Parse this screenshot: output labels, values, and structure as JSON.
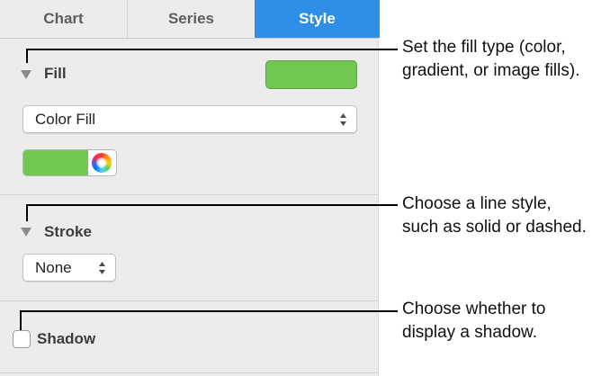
{
  "tabs": [
    {
      "label": "Chart",
      "active": false
    },
    {
      "label": "Series",
      "active": false
    },
    {
      "label": "Style",
      "active": true
    }
  ],
  "fill": {
    "title": "Fill",
    "swatch_color": "#71c751",
    "fill_type_value": "Color Fill",
    "well_color": "#71c751",
    "wheel_icon": "color-wheel-icon"
  },
  "stroke": {
    "title": "Stroke",
    "line_style_value": "None"
  },
  "shadow": {
    "label": "Shadow",
    "checked": false
  },
  "callouts": [
    {
      "lines": [
        "Set the fill type (color,",
        "gradient, or image fills)."
      ]
    },
    {
      "lines": [
        "Choose a line style,",
        "such as solid or dashed."
      ]
    },
    {
      "lines": [
        "Choose whether to",
        "display a shadow."
      ]
    }
  ],
  "colors": {
    "accent_tab": "#2f8fe6",
    "panel_bg": "#ececec"
  }
}
